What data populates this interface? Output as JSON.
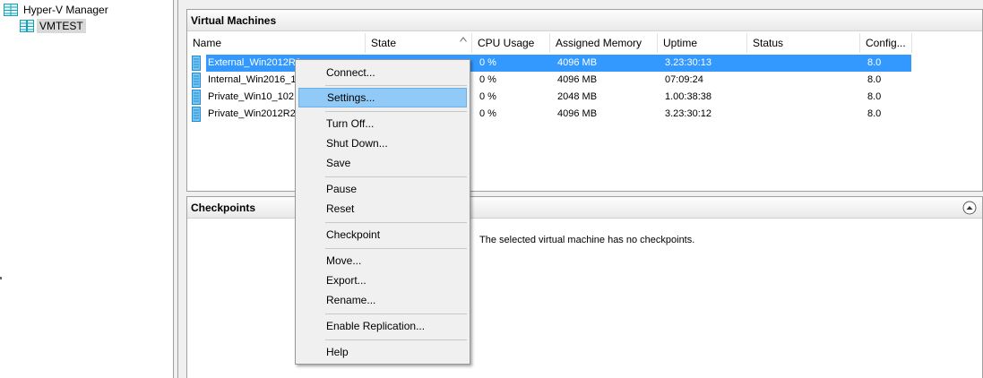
{
  "tree": {
    "root_label": "Hyper-V Manager",
    "server_label": "VMTEST"
  },
  "vm_panel": {
    "title": "Virtual Machines",
    "columns": [
      "Name",
      "State",
      "CPU Usage",
      "Assigned Memory",
      "Uptime",
      "Status",
      "Config..."
    ],
    "rows": [
      {
        "name": "External_Win2012R2",
        "state": "",
        "cpu": "0 %",
        "memory": "4096 MB",
        "uptime": "3.23:30:13",
        "status": "",
        "config": "8.0",
        "selected": true
      },
      {
        "name": "Internal_Win2016_10",
        "state": "",
        "cpu": "0 %",
        "memory": "4096 MB",
        "uptime": "07:09:24",
        "status": "",
        "config": "8.0",
        "selected": false
      },
      {
        "name": "Private_Win10_102.",
        "state": "",
        "cpu": "0 %",
        "memory": "2048 MB",
        "uptime": "1.00:38:38",
        "status": "",
        "config": "8.0",
        "selected": false
      },
      {
        "name": "Private_Win2012R2",
        "state": "",
        "cpu": "0 %",
        "memory": "4096 MB",
        "uptime": "3.23:30:12",
        "status": "",
        "config": "8.0",
        "selected": false
      }
    ]
  },
  "checkpoints_panel": {
    "title": "Checkpoints",
    "message": "The selected virtual machine has no checkpoints."
  },
  "context_menu": {
    "items": [
      {
        "label": "Connect...",
        "highlighted": false
      },
      {
        "label": "Settings...",
        "highlighted": true
      },
      {
        "label": "Turn Off...",
        "highlighted": false
      },
      {
        "label": "Shut Down...",
        "highlighted": false
      },
      {
        "label": "Save",
        "highlighted": false
      },
      {
        "label": "Pause",
        "highlighted": false
      },
      {
        "label": "Reset",
        "highlighted": false
      },
      {
        "label": "Checkpoint",
        "highlighted": false
      },
      {
        "label": "Move...",
        "highlighted": false
      },
      {
        "label": "Export...",
        "highlighted": false
      },
      {
        "label": "Rename...",
        "highlighted": false
      },
      {
        "label": "Enable Replication...",
        "highlighted": false
      },
      {
        "label": "Help",
        "highlighted": false
      }
    ]
  },
  "colors": {
    "selection": "#3399ff",
    "menu_highlight": "#91c9f7",
    "vm_icon": "#1c8fd6",
    "server_icon": "#17a0b5"
  }
}
